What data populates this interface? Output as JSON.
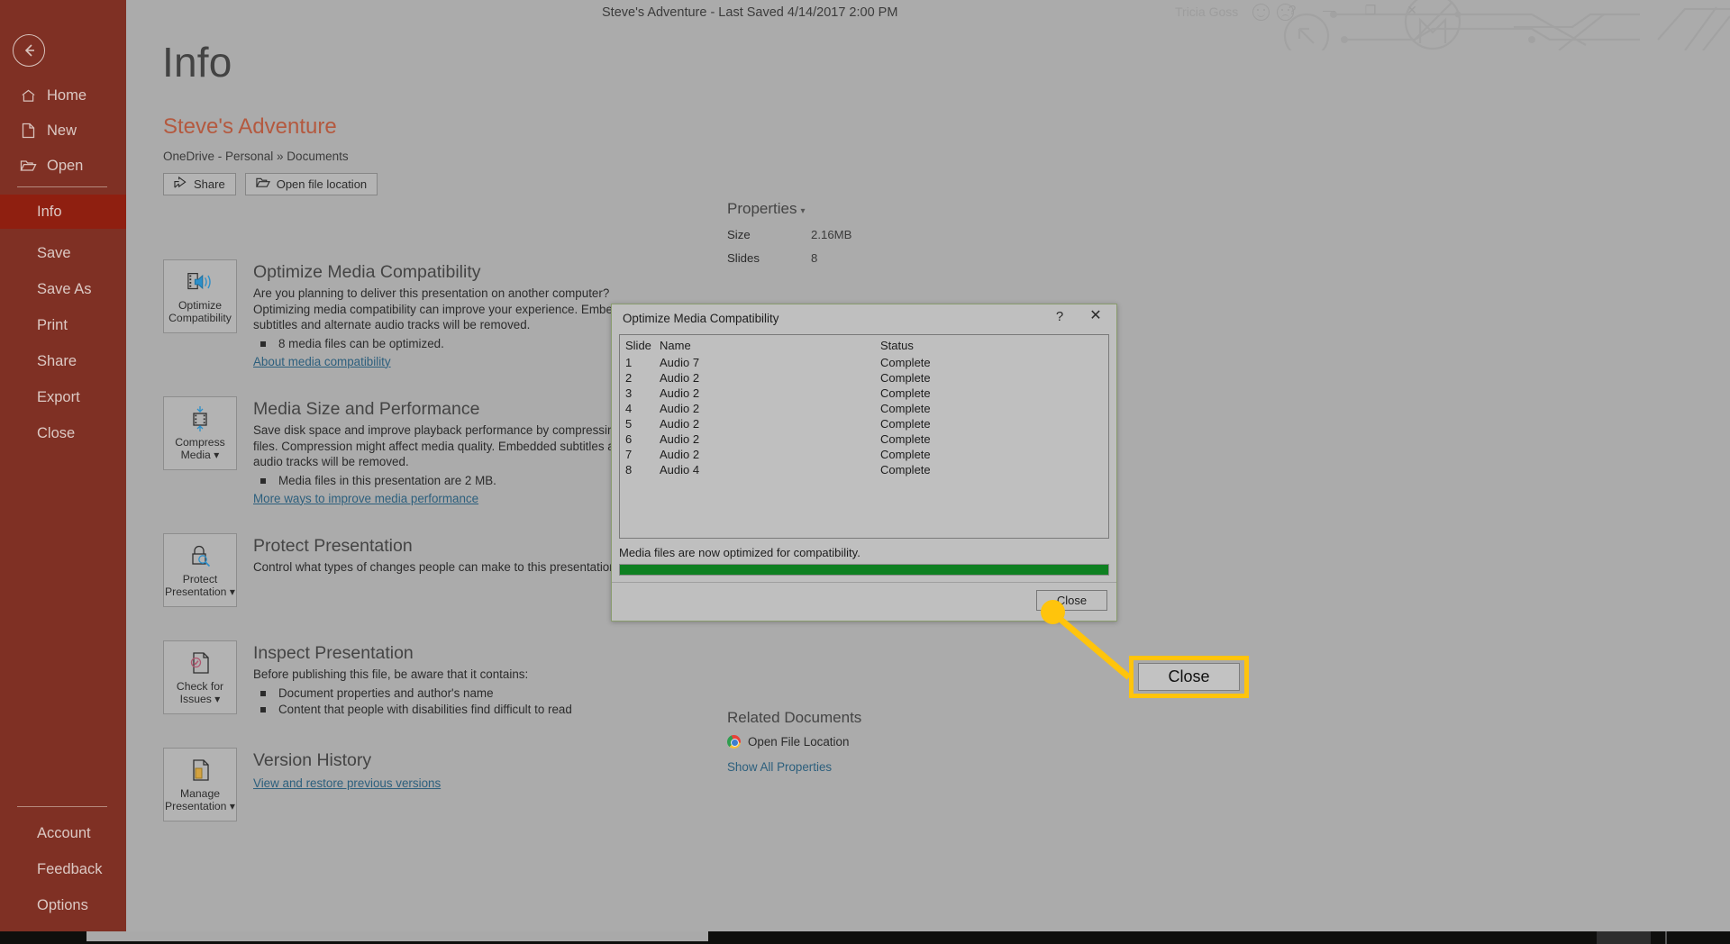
{
  "titlebar": {
    "doc_title": "Steve's Adventure  -  Last Saved 4/14/2017 2:00 PM",
    "user_name": "Tricia Goss",
    "help_label": "?",
    "minimize_label": "—",
    "restore_label": "❐",
    "close_label": "✕",
    "smiley_icon": "smiley-face-icon",
    "frown_icon": "frowning-face-icon"
  },
  "sidebar": {
    "back_icon": "back-arrow-icon",
    "accent_color": "#7f3024",
    "active_color": "#8f1f10",
    "items": [
      {
        "label": "Home",
        "icon": "home-icon",
        "active": false
      },
      {
        "label": "New",
        "icon": "page-icon",
        "active": false
      },
      {
        "label": "Open",
        "icon": "folder-icon",
        "active": false
      },
      {
        "label": "Info",
        "icon": "",
        "active": true
      },
      {
        "label": "Save",
        "icon": "",
        "active": false
      },
      {
        "label": "Save As",
        "icon": "",
        "active": false
      },
      {
        "label": "Print",
        "icon": "",
        "active": false
      },
      {
        "label": "Share",
        "icon": "",
        "active": false
      },
      {
        "label": "Export",
        "icon": "",
        "active": false
      },
      {
        "label": "Close",
        "icon": "",
        "active": false
      }
    ],
    "bottom_items": [
      {
        "label": "Account"
      },
      {
        "label": "Feedback"
      },
      {
        "label": "Options"
      }
    ]
  },
  "info": {
    "page_title": "Info",
    "file_name": "Steve's Adventure",
    "file_path": "OneDrive - Personal » Documents",
    "file_name_color": "#b4593f",
    "buttons": [
      {
        "label": "Share",
        "icon": "share-icon"
      },
      {
        "label": "Open file location",
        "icon": "folder-open-icon"
      }
    ],
    "sections": [
      {
        "icon_name": "optimize-compatibility-icon",
        "icon_caption_line1": "Optimize",
        "icon_caption_line2": "Compatibility",
        "heading": "Optimize Media Compatibility",
        "body": "Are you planning to deliver this presentation on another computer? Optimizing media compatibility can improve your experience. Embedded subtitles and alternate audio tracks will be removed.",
        "bullets": [
          "8 media files can be optimized."
        ],
        "link": "About media compatibility"
      },
      {
        "icon_name": "compress-media-icon",
        "icon_caption_line1": "Compress",
        "icon_caption_line2": "Media ▾",
        "heading": "Media Size and Performance",
        "body": "Save disk space and improve playback performance by compressing your files. Compression might affect media quality. Embedded subtitles and audio tracks will be removed.",
        "bullets": [
          "Media files in this presentation are 2 MB."
        ],
        "link": "More ways to improve media performance"
      },
      {
        "icon_name": "protect-presentation-icon",
        "icon_caption_line1": "Protect",
        "icon_caption_line2": "Presentation ▾",
        "heading": "Protect Presentation",
        "body": "Control what types of changes people can make to this presentation.",
        "bullets": [],
        "link": ""
      },
      {
        "icon_name": "check-for-issues-icon",
        "icon_caption_line1": "Check for",
        "icon_caption_line2": "Issues ▾",
        "heading": "Inspect Presentation",
        "body": "Before publishing this file, be aware that it contains:",
        "bullets": [
          "Document properties and author's name",
          "Content that people with disabilities find difficult to read"
        ],
        "link": ""
      },
      {
        "icon_name": "manage-presentation-icon",
        "icon_caption_line1": "Manage",
        "icon_caption_line2": "Presentation ▾",
        "heading": "Version History",
        "body": "",
        "bullets": [],
        "link": "View and restore previous versions"
      }
    ]
  },
  "properties": {
    "heading": "Properties",
    "rows": [
      {
        "key": "Size",
        "value": "2.16MB"
      },
      {
        "key": "Slides",
        "value": "8"
      }
    ],
    "related_documents_heading": "Related Documents",
    "open_file_location": "Open File Location",
    "open_file_location_icon": "chrome-icon",
    "show_all_properties": "Show All Properties"
  },
  "dialog": {
    "title": "Optimize Media Compatibility",
    "help_label": "?",
    "close_x_label": "✕",
    "columns": [
      "Slide",
      "Name",
      "Status"
    ],
    "rows": [
      {
        "slide": "1",
        "name": "Audio 7",
        "status": "Complete"
      },
      {
        "slide": "2",
        "name": "Audio 2",
        "status": "Complete"
      },
      {
        "slide": "3",
        "name": "Audio 2",
        "status": "Complete"
      },
      {
        "slide": "4",
        "name": "Audio 2",
        "status": "Complete"
      },
      {
        "slide": "5",
        "name": "Audio 2",
        "status": "Complete"
      },
      {
        "slide": "6",
        "name": "Audio 2",
        "status": "Complete"
      },
      {
        "slide": "7",
        "name": "Audio 2",
        "status": "Complete"
      },
      {
        "slide": "8",
        "name": "Audio 4",
        "status": "Complete"
      }
    ],
    "status_text": "Media files are now optimized for compatibility.",
    "progress_percent": 100,
    "progress_color": "#0e8021",
    "close_button": "Close"
  },
  "callout": {
    "label": "Close",
    "highlight_color": "#ffc40c"
  }
}
